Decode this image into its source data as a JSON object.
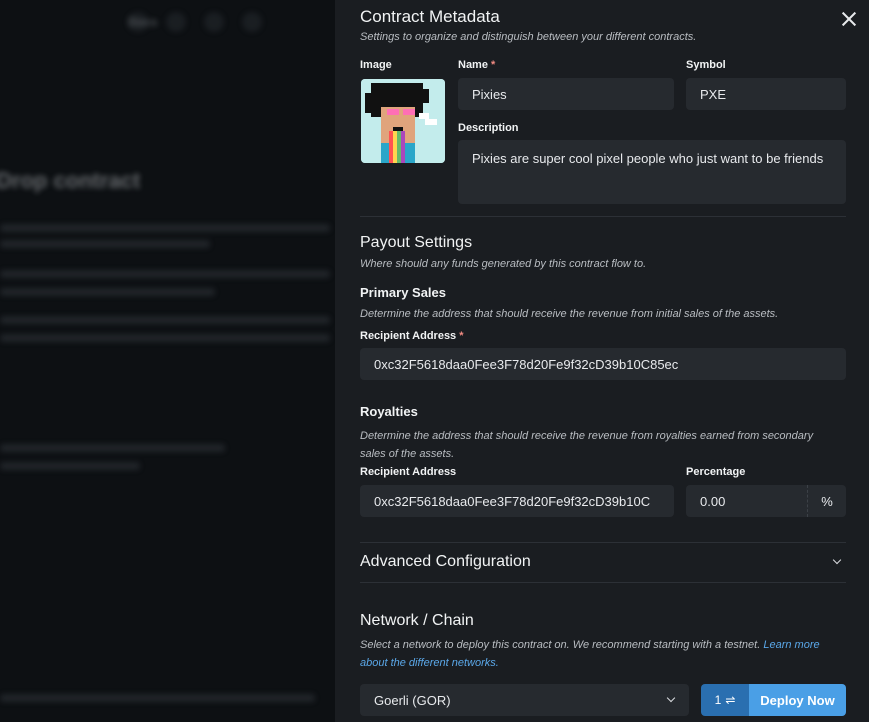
{
  "background": {
    "nav_label": "Docs",
    "title": "Drop contract"
  },
  "drawer": {
    "metadata": {
      "title": "Contract Metadata",
      "subtitle": "Settings to organize and distinguish between your different contracts.",
      "image_label": "Image",
      "name_label": "Name",
      "name_value": "Pixies",
      "symbol_label": "Symbol",
      "symbol_value": "PXE",
      "description_label": "Description",
      "description_value": "Pixies are super cool pixel people who just want to be friends"
    },
    "payout": {
      "title": "Payout Settings",
      "subtitle": "Where should any funds generated by this contract flow to.",
      "primary_title": "Primary Sales",
      "primary_subtitle": "Determine the address that should receive the revenue from initial sales of the assets.",
      "recipient_label": "Recipient Address",
      "primary_recipient": "0xc32F5618daa0Fee3F78d20Fe9f32cD39b10C85ec",
      "royalties_title": "Royalties",
      "royalties_subtitle": "Determine the address that should receive the revenue from royalties earned from secondary sales of the assets.",
      "royalty_recipient_label": "Recipient Address",
      "royalty_recipient": "0xc32F5618daa0Fee3F78d20Fe9f32cD39b10C",
      "percentage_label": "Percentage",
      "percentage_value": "0.00",
      "percentage_suffix": "%"
    },
    "advanced": {
      "title": "Advanced Configuration"
    },
    "network": {
      "title": "Network / Chain",
      "subtitle_prefix": "Select a network to deploy this contract on. We recommend starting with a testnet.",
      "subtitle_link": "Learn more about the different networks.",
      "selected": "Goerli (GOR)",
      "qty": "1",
      "deploy_label": "Deploy Now"
    }
  },
  "colors": {
    "accent": "#4a9fe6",
    "panel": "#1a1d21",
    "input": "#262a2f"
  }
}
